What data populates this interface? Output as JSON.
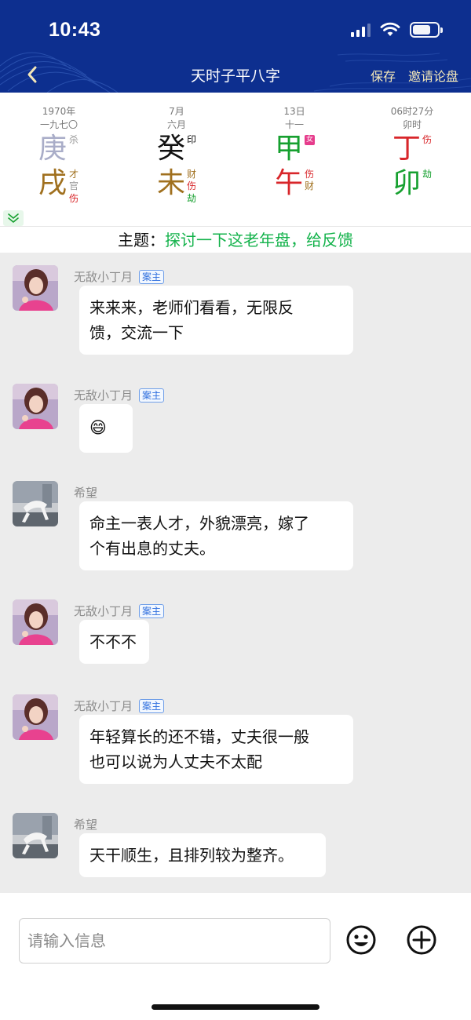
{
  "status": {
    "time": "10:43"
  },
  "nav": {
    "back_icon": "chevron-left-icon",
    "title": "天时子平八字",
    "save": "保存",
    "invite": "邀请论盘"
  },
  "bazi": {
    "pillars": [
      {
        "date1": "1970年",
        "date2": "一九七〇",
        "stem": "庚",
        "stem_color": "#a9adc8",
        "stem_tag": "杀",
        "stem_tag_color": "#9a9a9a",
        "branch": "戌",
        "branch_color": "#a0701e",
        "branch_tags": [
          {
            "t": "才",
            "c": "#a0701e"
          },
          {
            "t": "官",
            "c": "#9a9a9a"
          },
          {
            "t": "伤",
            "c": "#d8262a"
          }
        ]
      },
      {
        "date1": "7月",
        "date2": "六月",
        "stem": "癸",
        "stem_color": "#111111",
        "stem_tag": "印",
        "stem_tag_color": "#111111",
        "branch": "未",
        "branch_color": "#a0701e",
        "branch_tags": [
          {
            "t": "财",
            "c": "#a0701e"
          },
          {
            "t": "伤",
            "c": "#d8262a"
          },
          {
            "t": "劫",
            "c": "#16a02f"
          }
        ]
      },
      {
        "date1": "13日",
        "date2": "十一",
        "stem": "甲",
        "stem_color": "#16a02f",
        "stem_tag": "女",
        "stem_tag_color": "#ffffff",
        "branch": "午",
        "branch_color": "#d8262a",
        "branch_tags": [
          {
            "t": "伤",
            "c": "#d8262a"
          },
          {
            "t": "财",
            "c": "#a0701e"
          }
        ]
      },
      {
        "date1": "06时27分",
        "date2": "卯时",
        "stem": "丁",
        "stem_color": "#d8262a",
        "stem_tag": "伤",
        "stem_tag_color": "#d8262a",
        "branch": "卯",
        "branch_color": "#16a02f",
        "branch_tags": [
          {
            "t": "劫",
            "c": "#16a02f"
          }
        ]
      }
    ]
  },
  "topic": {
    "label": "主题：",
    "text": "探讨一下这老年盘，给反馈"
  },
  "messages": [
    {
      "name": "无敌小丁月",
      "badge": "案主",
      "text1": "来来来，老师们看看，无限反",
      "text2": "馈，交流一下"
    },
    {
      "name": "无敌小丁月",
      "badge": "案主",
      "emoji": "😄"
    },
    {
      "name": "希望",
      "text1": "命主一表人才，外貌漂亮，嫁了",
      "text2": "个有出息的丈夫。"
    },
    {
      "name": "无敌小丁月",
      "badge": "案主",
      "text1": "不不不"
    },
    {
      "name": "无敌小丁月",
      "badge": "案主",
      "text1": "年轻算长的还不错，丈夫很一般",
      "text2": "也可以说为人丈夫不太配"
    },
    {
      "name": "希望",
      "text1": "天干顺生，且排列较为整齐。"
    }
  ],
  "input": {
    "placeholder": "请输入信息",
    "emoji_icon": "smiley-icon",
    "plus_icon": "plus-circle-icon"
  }
}
